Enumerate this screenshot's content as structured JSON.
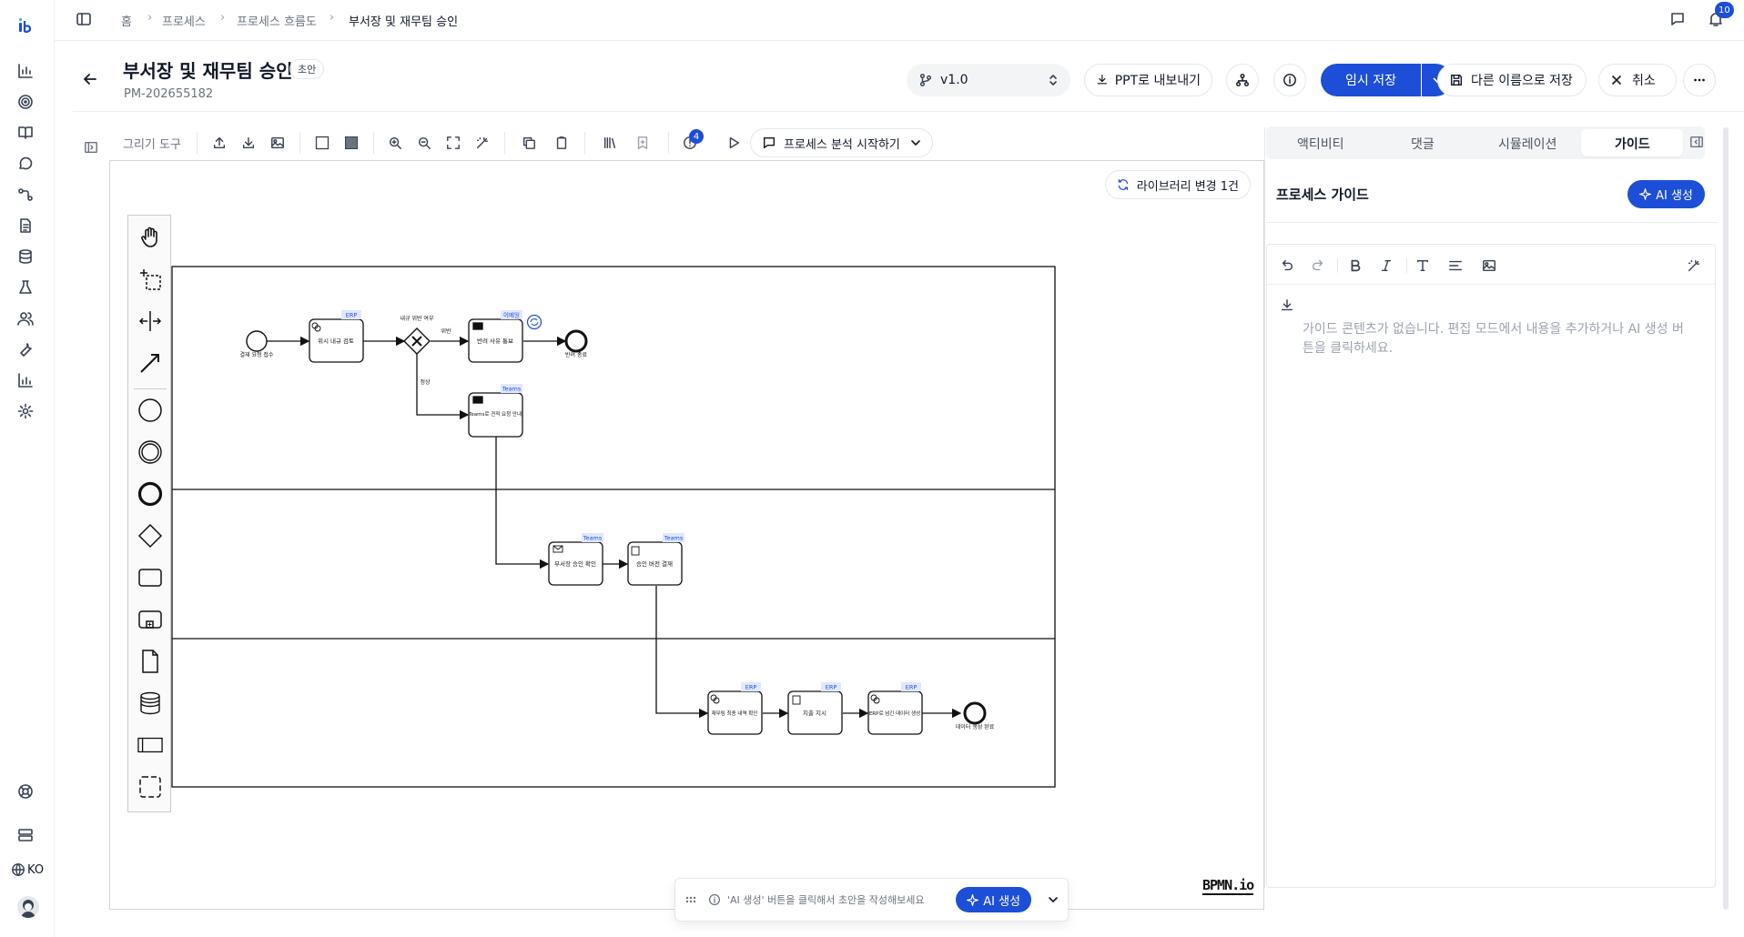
{
  "rail": {
    "items": [
      "logo-icon",
      "chart-icon",
      "target-icon",
      "book-icon",
      "chat-icon",
      "flow-icon",
      "document-icon",
      "database-icon",
      "flask-icon",
      "users-icon",
      "wrench-icon",
      "bar-chart-icon",
      "gear-icon"
    ],
    "bottom": [
      "help-icon",
      "server-icon",
      "globe-icon",
      "avatar"
    ],
    "lang": "KO"
  },
  "breadcrumb": [
    "홈",
    "프로세스",
    "프로세스 흐름도",
    "부서장 및 재무팀 승인"
  ],
  "notifications": {
    "count": "10"
  },
  "header": {
    "title": "부서장 및 재무팀 승인",
    "status": "초안",
    "id": "PM-202655182",
    "version": "v1.0",
    "export_ppt": "PPT로 내보내기",
    "save_draft": "임시 저장",
    "save_as": "다른 이름으로 저장",
    "cancel": "취소"
  },
  "toolbar": {
    "drawing_tools": "그리기 도구",
    "badge_count": "4",
    "analyze": "프로세스 분석 시작하기"
  },
  "canvas": {
    "library_changes": "라이브러리 변경 1건",
    "watermark": "BPMN.io",
    "hint": "'AI 생성' 버튼을 클릭해서 초안을 작성해보세요",
    "hint_button": "AI 생성"
  },
  "diagram": {
    "lane1": {
      "start_label": "결재 요청 접수",
      "task1": "위시 내규 검토",
      "task1_tag": "ERP",
      "gateway_label": "내규 위반 여부",
      "gw_yes": "위반",
      "gw_no": "정상",
      "task2": "반려 사유 통보",
      "task2_tag": "이메일",
      "end_label": "반려 종료",
      "task3": "Teams로 견적 요청 안내",
      "task3_tag": "Teams"
    },
    "lane2": {
      "task4": "부서장 승인 확인",
      "task4_tag": "Teams",
      "task5": "승인 버전 결재",
      "task5_tag": "Teams"
    },
    "lane3": {
      "task6": "재무팀 최종 내역 확인",
      "task6_tag": "ERP",
      "task7": "지출 지시",
      "task7_tag": "ERP",
      "task8": "ERP로 넘긴 데이터 생성",
      "task8_tag": "ERP",
      "end_label": "데이터 생성 완료"
    }
  },
  "panel": {
    "tabs": [
      "액티비티",
      "댓글",
      "시뮬레이션",
      "가이드"
    ],
    "active_tab": "가이드",
    "title": "프로세스 가이드",
    "ai_button": "AI 생성",
    "empty_text": "가이드 콘텐츠가 없습니다. 편집 모드에서 내용을 추가하거나 AI 생성 버튼을 클릭하세요."
  },
  "colors": {
    "primary": "#1d4ed8",
    "border": "#e5e7eb"
  }
}
